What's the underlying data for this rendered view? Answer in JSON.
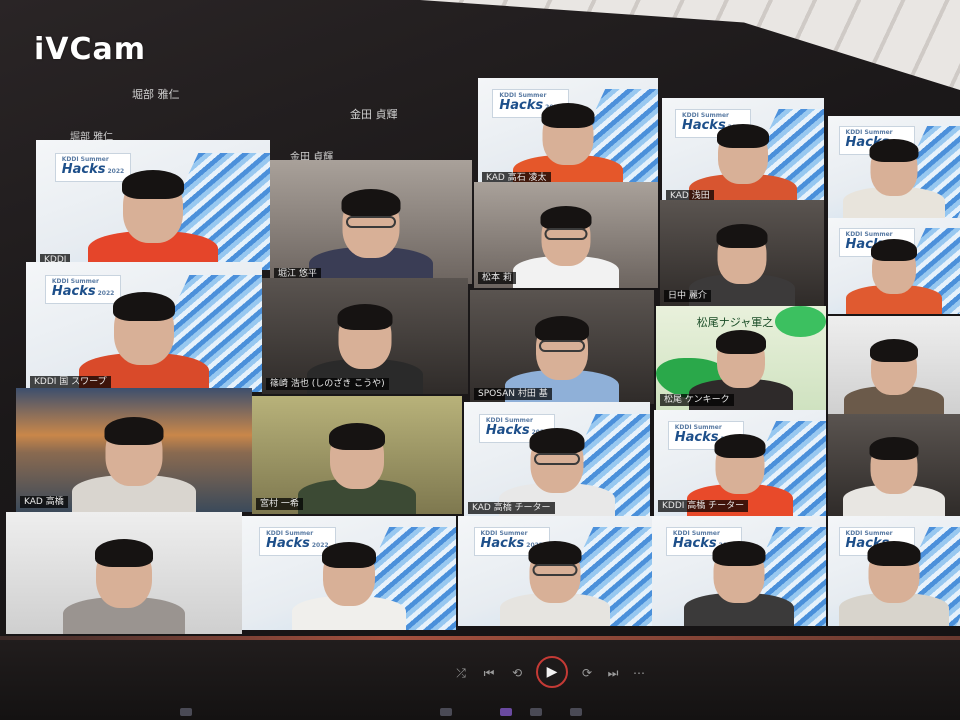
{
  "watermark": "iVCam",
  "top_labels": [
    {
      "text": "堀部 雅仁"
    },
    {
      "text": "金田 貞輝"
    },
    {
      "text": "堀部 雅仁"
    },
    {
      "text": "金田 貞輝"
    }
  ],
  "logo": {
    "brand": "Hacks",
    "small": "KDDI Summer",
    "sub": "2022"
  },
  "tiles": [
    {
      "id": "r0c0",
      "name": "KAD 高石 凌太",
      "bg": "hacks",
      "shirt": "#e5572a"
    },
    {
      "id": "r0c1",
      "name": "KAD 浅田",
      "bg": "hacks",
      "shirt": "#d85530"
    },
    {
      "id": "r0c2",
      "name": "",
      "bg": "hacks",
      "shirt": "#e8e4dc"
    },
    {
      "id": "r1c0",
      "name": "KDDI",
      "bg": "hacks",
      "shirt": "#e5452a"
    },
    {
      "id": "r1c1",
      "name": "堀江 悠平",
      "bg": "room",
      "shirt": "#3a3d55"
    },
    {
      "id": "r1c2",
      "name": "松本 莉",
      "bg": "room",
      "shirt": "#f2f2f2"
    },
    {
      "id": "r1c3",
      "name": "日中 麗介",
      "bg": "dark",
      "shirt": "#3c3a3a"
    },
    {
      "id": "r1c4",
      "name": "",
      "bg": "hacks",
      "shirt": "#e05a30"
    },
    {
      "id": "r2c0",
      "name": "KDDI 国 スワープ",
      "bg": "hacks",
      "shirt": "#d94a2a"
    },
    {
      "id": "r2c1",
      "name": "篠崎 浩也 (しのざき こうや)",
      "bg": "dark",
      "shirt": "#2a2a2a"
    },
    {
      "id": "r2c2",
      "name": "SPOSAN 村田 基",
      "bg": "dark",
      "shirt": "#8fb0d8"
    },
    {
      "id": "r2c3",
      "name": "松尾 ケンキーク",
      "bg": "green",
      "shirt": "#2e2a2a",
      "overlay": "松尾ナジャ軍之"
    },
    {
      "id": "r2c4",
      "name": "",
      "bg": "white",
      "shirt": "#6b5a4a"
    },
    {
      "id": "r3c0",
      "name": "KAD 高橋",
      "bg": "sunset",
      "shirt": "#d9d5cf"
    },
    {
      "id": "r3c1",
      "name": "宮村 一希",
      "bg": "yellow",
      "shirt": "#3c4a34"
    },
    {
      "id": "r3c2",
      "name": "KAD 高橋 チーター",
      "bg": "hacks",
      "shirt": "#e8e8e8"
    },
    {
      "id": "r3c3",
      "name": "KDDI 高橋 チーター",
      "bg": "hacks",
      "shirt": "#e84a2a"
    },
    {
      "id": "r3c4",
      "name": "",
      "bg": "dark",
      "shirt": "#e8e6e2"
    },
    {
      "id": "r4c0",
      "name": "",
      "bg": "white",
      "shirt": "#9a9490"
    },
    {
      "id": "r4c1",
      "name": "",
      "bg": "hacks",
      "shirt": "#f0efec"
    },
    {
      "id": "r4c2",
      "name": "",
      "bg": "hacks",
      "shirt": "#e6e4e0"
    },
    {
      "id": "r4c3",
      "name": "",
      "bg": "hacks",
      "shirt": "#3b3a3a"
    },
    {
      "id": "r4c4",
      "name": "",
      "bg": "hacks",
      "shirt": "#d8d4cc"
    }
  ],
  "controls": {
    "shuffle_icon": "shuffle-icon",
    "prev_icon": "skip-back-icon",
    "repeat_icon": "repeat-icon",
    "play_icon": "play-icon",
    "next_icon": "skip-forward-icon",
    "loop_icon": "loop-icon",
    "glyphs": {
      "shuffle": "⤮",
      "prev": "⏮",
      "repeat": "⟲",
      "play": "▶",
      "next": "⏭",
      "loop": "⟳"
    }
  }
}
